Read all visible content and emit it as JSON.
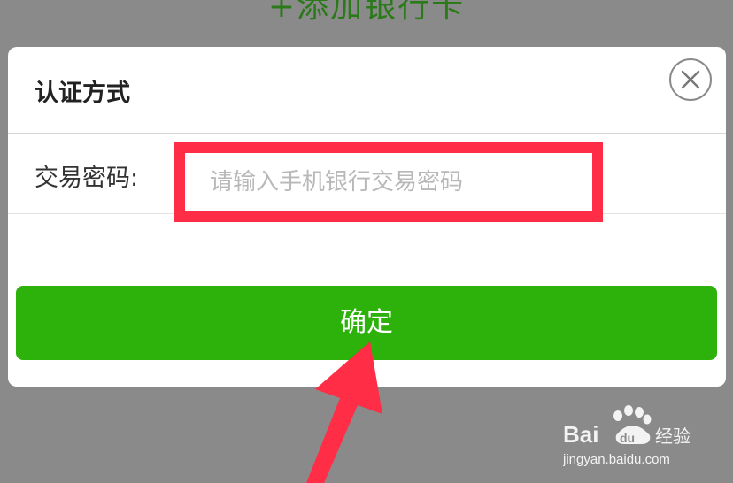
{
  "background": {
    "title": "+添加银行卡"
  },
  "modal": {
    "title": "认证方式",
    "close_icon": "close-icon",
    "form": {
      "password_label": "交易密码:",
      "password_placeholder": "请输入手机银行交易密码",
      "password_value": ""
    },
    "confirm_label": "确定"
  },
  "annotation": {
    "highlight_color": "#ff2d46",
    "arrow_color": "#ff2d46"
  },
  "watermark": {
    "brand": "Baidu经验",
    "url": "jingyan.baidu.com"
  },
  "colors": {
    "accent_green": "#2db10b",
    "overlay_gray": "#8a8a8a"
  }
}
